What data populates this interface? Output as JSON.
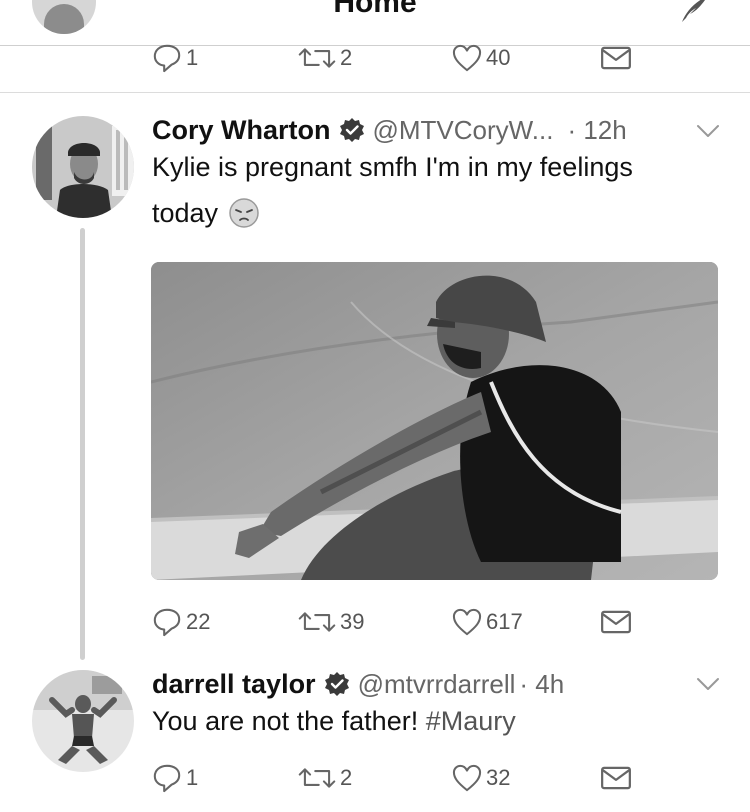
{
  "header": {
    "title": "Home"
  },
  "icons": {
    "reply": "reply-icon",
    "retweet": "retweet-icon",
    "like": "heart-icon",
    "dm": "envelope-icon",
    "compose": "compose-feather-icon",
    "verified": "verified-badge-icon",
    "menu": "chevron-down-icon"
  },
  "colors": {
    "text": "#111111",
    "secondary": "#666666",
    "divider": "#dcdcdc"
  },
  "top_tweet": {
    "replies": "1",
    "retweets": "2",
    "likes": "40"
  },
  "tweets": [
    {
      "name": "Cory Wharton",
      "verified": true,
      "handle": "@MTVCoryW...",
      "time": "· 12h",
      "text_line1": "Kylie is pregnant smfh I'm in my feelings",
      "text_line2": "today",
      "emoji": "pensive-face-emoji",
      "has_image": true,
      "replies": "22",
      "retweets": "39",
      "likes": "617"
    },
    {
      "name": "darrell taylor",
      "verified": true,
      "handle": "@mtvrrdarrell",
      "time": "· 4h",
      "text": "You are not the father! ",
      "hashtag": "#Maury",
      "replies": "1",
      "retweets": "2",
      "likes": "32"
    }
  ]
}
